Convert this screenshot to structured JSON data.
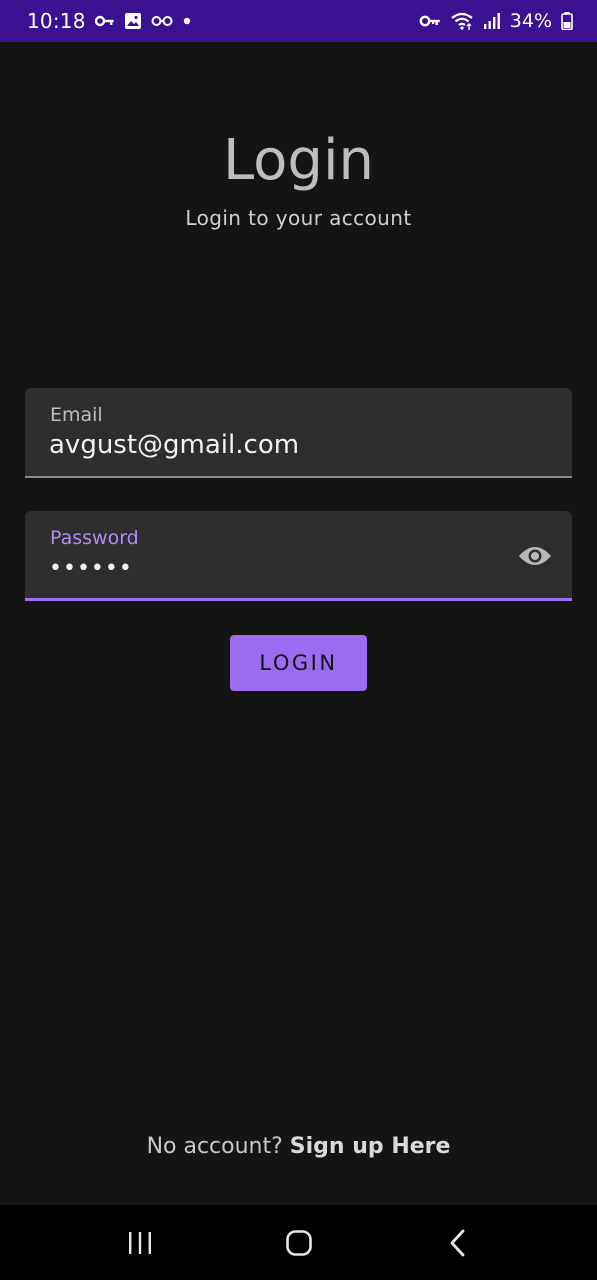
{
  "status_bar": {
    "time": "10:18",
    "battery": "34%",
    "icons_left": [
      "key-icon",
      "image-icon",
      "glasses-icon",
      "dot-icon"
    ],
    "icons_right": [
      "vpn-key-icon",
      "wifi-icon",
      "signal-icon",
      "battery-icon"
    ]
  },
  "header": {
    "title": "Login",
    "subtitle": "Login to your account"
  },
  "form": {
    "email": {
      "label": "Email",
      "value": "avgust@gmail.com"
    },
    "password": {
      "label": "Password",
      "value": "••••••"
    },
    "login_label": "LOGIN"
  },
  "footer": {
    "prompt": "No account?",
    "link": "Sign up Here"
  },
  "colors": {
    "background": "#141414",
    "status_bar": "#3a1190",
    "accent": "#9b6cf0",
    "field_bg": "#2e2e2e"
  }
}
